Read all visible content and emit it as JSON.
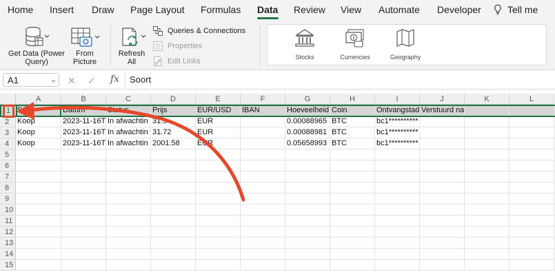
{
  "ribbon_tabs": [
    {
      "label": "Home"
    },
    {
      "label": "Insert"
    },
    {
      "label": "Draw"
    },
    {
      "label": "Page Layout"
    },
    {
      "label": "Formulas"
    },
    {
      "label": "Data",
      "active": true
    },
    {
      "label": "Review"
    },
    {
      "label": "View"
    },
    {
      "label": "Automate"
    },
    {
      "label": "Developer"
    },
    {
      "label": "Tell me",
      "icon": "lightbulb-icon"
    }
  ],
  "ribbon": {
    "get_data": {
      "line1": "Get Data (Power",
      "line2": "Query)",
      "icon": "database-icon"
    },
    "from_picture": {
      "line1": "From",
      "line2": "Picture",
      "icon": "table-camera-icon"
    },
    "refresh_all": {
      "line1": "Refresh",
      "line2": "All",
      "icon": "refresh-icon"
    },
    "queries_connections": {
      "label": "Queries & Connections",
      "icon": "queries-icon"
    },
    "properties": {
      "label": "Properties",
      "icon": "properties-icon",
      "disabled": true
    },
    "edit_links": {
      "label": "Edit Links",
      "icon": "edit-links-icon",
      "disabled": true
    },
    "data_types": [
      {
        "label": "Stocks",
        "icon": "bank-icon"
      },
      {
        "label": "Currencies",
        "icon": "currency-icon"
      },
      {
        "label": "Geography",
        "icon": "map-icon"
      }
    ]
  },
  "formula_bar": {
    "name_box": "A1",
    "fx_label": "fx",
    "formula": "Soort"
  },
  "sheet": {
    "columns": [
      "A",
      "B",
      "C",
      "D",
      "E",
      "F",
      "G",
      "H",
      "I",
      "J",
      "K",
      "L"
    ],
    "row_numbers": [
      "1",
      "2",
      "3",
      "4",
      "5",
      "6",
      "7",
      "8",
      "9",
      "10",
      "11",
      "12",
      "13",
      "14",
      "15"
    ],
    "rows": [
      [
        "Soo",
        "Datum",
        "Status",
        "Prijs",
        "EUR/USD",
        "IBAN",
        "Hoeveelheid",
        "Coin",
        "Ontvangstad",
        "Verstuurd naar",
        "",
        ""
      ],
      [
        "Koop",
        "2023-11-16T",
        "In afwachtin",
        "31.9",
        "EUR",
        "",
        "0.00088965",
        "BTC",
        "bc1**********",
        "",
        "",
        ""
      ],
      [
        "Koop",
        "2023-11-16T",
        "In afwachtin",
        "31.72",
        "EUR",
        "",
        "0.00088981",
        "BTC",
        "bc1**********",
        "",
        "",
        ""
      ],
      [
        "Koop",
        "2023-11-16T",
        "In afwachtin",
        "2001.58",
        "EUR",
        "",
        "0.05658993",
        "BTC",
        "bc1**********",
        "",
        "",
        ""
      ]
    ],
    "selected_row": "1",
    "active_cell": "A1"
  },
  "colors": {
    "accent": "#217346",
    "annotation": "#e5482b"
  }
}
